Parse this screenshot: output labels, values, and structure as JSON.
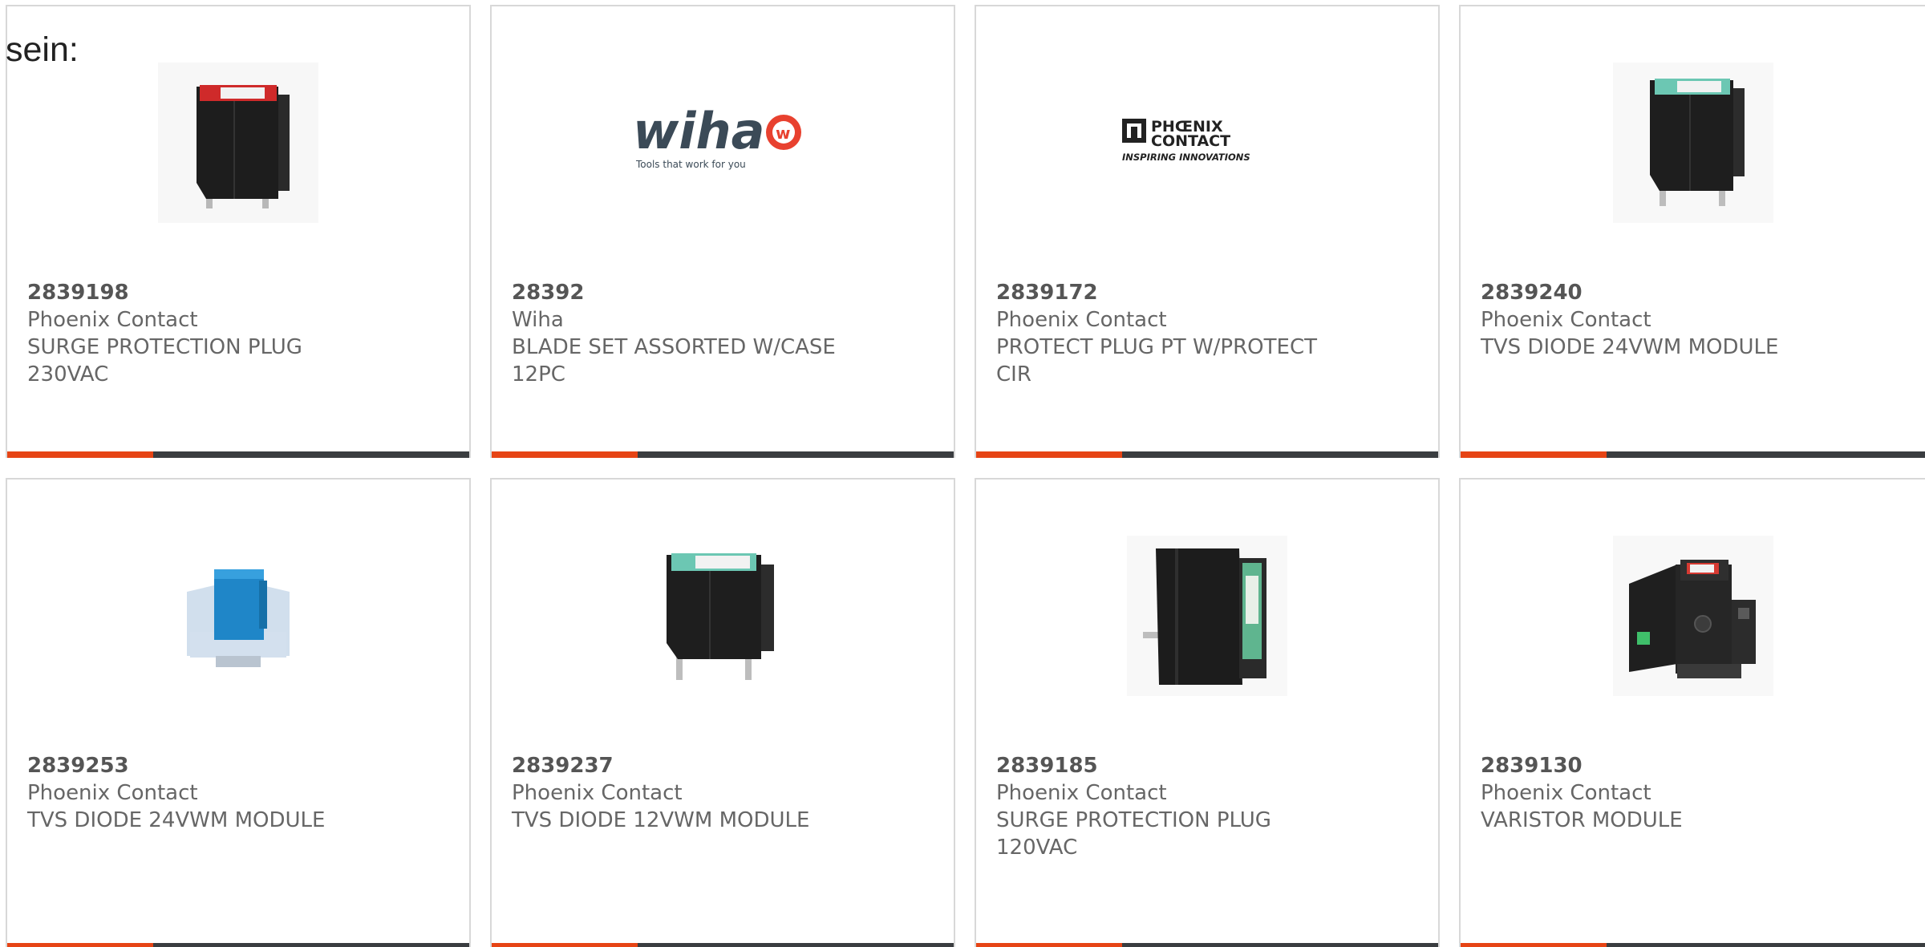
{
  "intro_text": "sein:",
  "colors": {
    "accent": "#e64415",
    "bar": "#3a3d40",
    "text": "#666666",
    "border": "#d8d8d8"
  },
  "products": [
    {
      "part_number": "2839198",
      "manufacturer": "Phoenix Contact",
      "description": "SURGE PROTECTION PLUG\n230VAC",
      "image": "surge-plug-red-label"
    },
    {
      "part_number": "28392",
      "manufacturer": "Wiha",
      "description": "BLADE SET ASSORTED W/CASE\n12PC",
      "image": "wiha-logo",
      "logo_text": "wiha",
      "logo_tagline": "Tools that work for you"
    },
    {
      "part_number": "2839172",
      "manufacturer": "Phoenix Contact",
      "description": "PROTECT PLUG PT W/PROTECT\nCIR",
      "image": "phoenix-contact-logo",
      "logo_line1": "PHŒNIX",
      "logo_line2": "CONTACT",
      "logo_tagline": "INSPIRING INNOVATIONS"
    },
    {
      "part_number": "2839240",
      "manufacturer": "Phoenix Contact",
      "description": "TVS DIODE 24VWM MODULE",
      "image": "tvs-plug-green-label"
    },
    {
      "part_number": "2839253",
      "manufacturer": "Phoenix Contact",
      "description": "TVS DIODE 24VWM MODULE",
      "image": "blue-din-module"
    },
    {
      "part_number": "2839237",
      "manufacturer": "Phoenix Contact",
      "description": "TVS DIODE 12VWM MODULE",
      "image": "tvs-plug-green-label"
    },
    {
      "part_number": "2839185",
      "manufacturer": "Phoenix Contact",
      "description": "SURGE PROTECTION PLUG\n120VAC",
      "image": "surge-plug-side-view"
    },
    {
      "part_number": "2839130",
      "manufacturer": "Phoenix Contact",
      "description": "VARISTOR MODULE",
      "image": "varistor-din-module"
    }
  ]
}
